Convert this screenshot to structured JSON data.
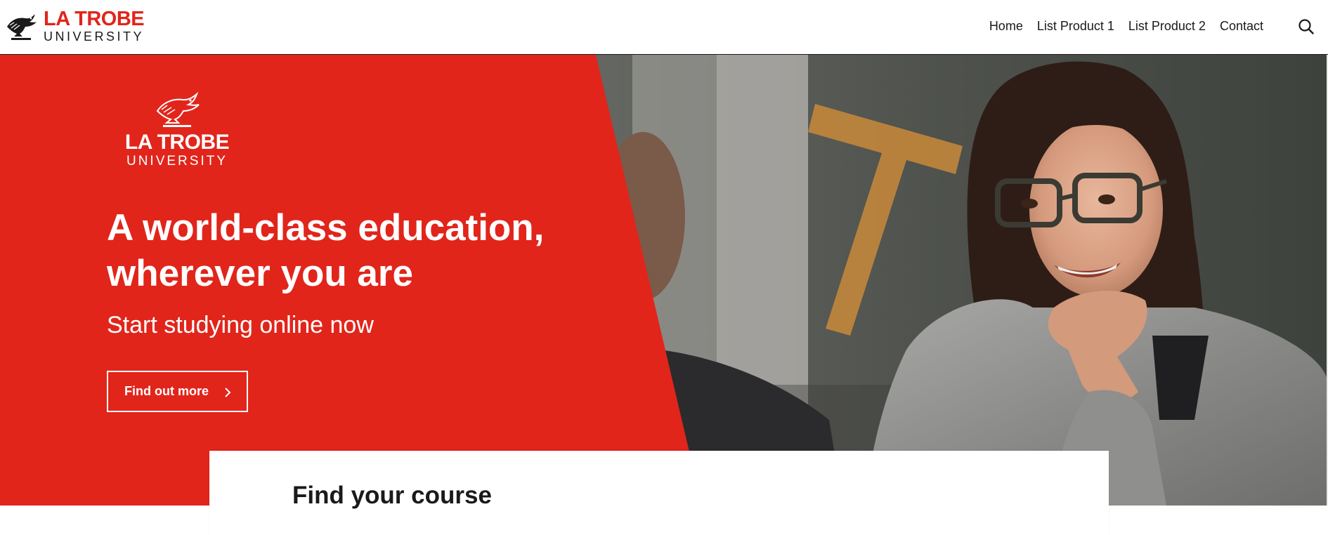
{
  "brand": {
    "logo_line1": "LA TROBE",
    "logo_line2": "UNIVERSITY",
    "logo_icon": "eagle-emblem-icon",
    "accent_color": "#e1251b"
  },
  "nav": {
    "items": [
      {
        "label": "Home"
      },
      {
        "label": "List Product 1"
      },
      {
        "label": "List Product 2"
      },
      {
        "label": "Contact"
      }
    ],
    "search_icon": "search-icon"
  },
  "hero": {
    "logo_line1": "LA TROBE",
    "logo_line2": "UNIVERSITY",
    "title_line1": "A world-class education,",
    "title_line2": "wherever you are",
    "subtitle": "Start studying online now",
    "cta_label": "Find out more",
    "cta_icon": "chevron-right-icon",
    "background_color": "#e1251b"
  },
  "course_finder": {
    "title": "Find your course"
  }
}
